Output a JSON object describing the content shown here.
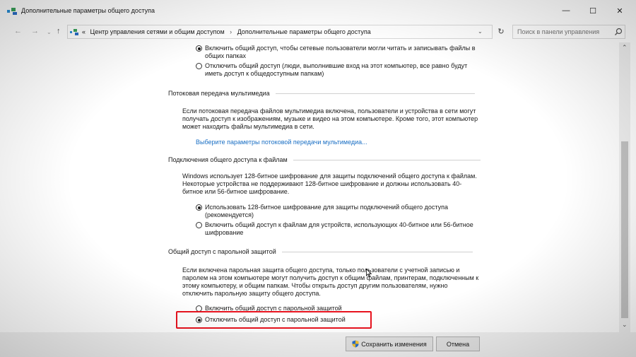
{
  "window": {
    "title": "Дополнительные параметры общего доступа",
    "minimize": "—",
    "maximize": "☐",
    "close": "✕"
  },
  "address": {
    "back": "←",
    "forward": "→",
    "dropdown": "⌄",
    "up": "↑",
    "crumb_prefix": "«",
    "crumbs": [
      "Центр управления сетями и общим доступом",
      "Дополнительные параметры общего доступа"
    ],
    "separator": "›",
    "refresh": "↻",
    "search_placeholder": "Поиск в панели управления"
  },
  "top_options": [
    {
      "text": "Включить общий доступ, чтобы сетевые пользователи могли читать и записывать файлы в общих папках",
      "selected": true
    },
    {
      "text": "Отключить общий доступ (люди, выполнившие вход на этот компьютер, все равно будут иметь доступ к общедоступным папкам)",
      "selected": false
    }
  ],
  "media": {
    "heading": "Потоковая передача мультимедиа",
    "text": "Если потоковая передача файлов мультимедиа включена, пользователи и устройства в сети могут получать доступ к изображениям, музыке и видео на этом компьютере. Кроме того, этот компьютер может находить файлы мультимедиа в сети.",
    "link": "Выберите параметры потоковой передачи мультимедиа..."
  },
  "file_sharing": {
    "heading": "Подключения общего доступа к файлам",
    "text": "Windows использует 128-битное шифрование для защиты подключений общего доступа к файлам. Некоторые устройства не поддерживают 128-битное шифрование и должны использовать 40-битное или 56-битное шифрование.",
    "options": [
      {
        "text": "Использовать 128-битное шифрование для защиты подключений общего доступа (рекомендуется)",
        "selected": true
      },
      {
        "text": "Включить общий доступ к файлам для устройств, использующих 40-битное или 56-битное шифрование",
        "selected": false
      }
    ]
  },
  "password": {
    "heading": "Общий доступ с парольной защитой",
    "text": "Если включена парольная защита общего доступа, только пользователи с учетной записью и паролем на этом компьютере могут получить доступ к общим файлам, принтерам, подключенным к этому компьютеру, и общим папкам. Чтобы открыть доступ другим пользователям, нужно отключить парольную защиту общего доступа.",
    "options": [
      {
        "text": "Включить общий доступ с парольной защитой",
        "selected": false
      },
      {
        "text": "Отключить общий доступ с парольной защитой",
        "selected": true
      }
    ]
  },
  "buttons": {
    "save": "Сохранить изменения",
    "cancel": "Отмена"
  },
  "colors": {
    "highlight": "#e8121e",
    "link": "#1a6fc4"
  },
  "icons": {
    "app": "network-icon",
    "shield": "uac-shield-icon",
    "search": "search-icon"
  }
}
